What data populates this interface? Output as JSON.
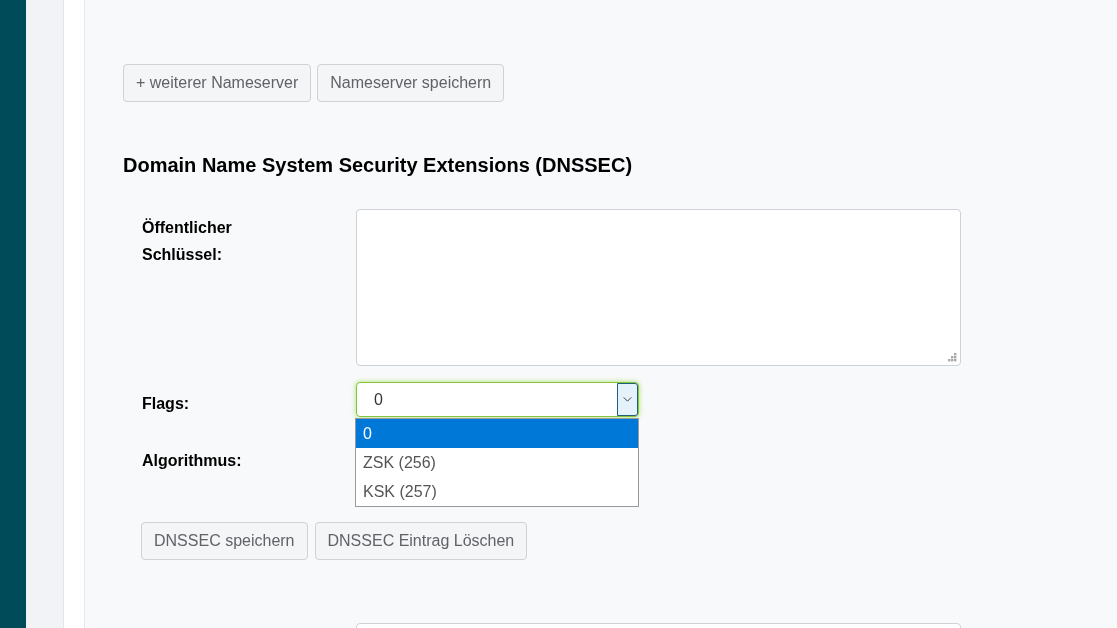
{
  "nameserver_actions": [
    "+ weiterer Nameserver",
    "Nameserver speichern"
  ],
  "dnssec": {
    "title": "Domain Name System Security Extensions (DNSSEC)",
    "public_key": {
      "label": "Öffentlicher Schlüssel:"
    },
    "flags": {
      "label": "Flags:",
      "value": "0",
      "focused": true,
      "expanded": true,
      "options": [
        {
          "label": "0",
          "selected": true
        },
        {
          "label": "ZSK (256)",
          "selected": false
        },
        {
          "label": "KSK (257)",
          "selected": false
        }
      ]
    },
    "algorithm": {
      "label": "Algorithmus:"
    },
    "actions": [
      "DNSSEC speichern",
      "DNSSEC Eintrag Löschen"
    ]
  }
}
